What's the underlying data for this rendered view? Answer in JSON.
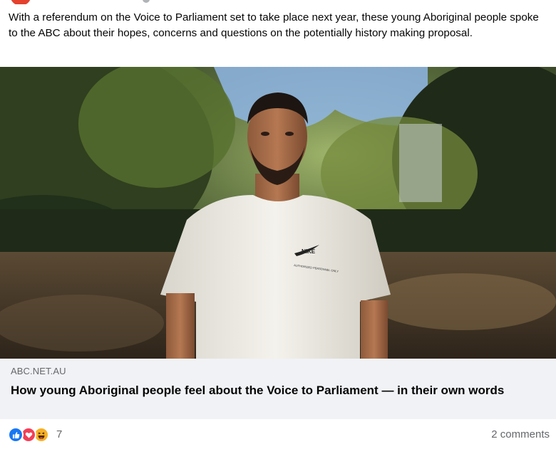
{
  "post": {
    "text": "With a referendum on the Voice to Parliament set to take place next year, these young Aboriginal people spoke to the ABC about their hopes, concerns and questions on the potentially history making proposal."
  },
  "link_preview": {
    "domain": "ABC.NET.AU",
    "title": "How young Aboriginal people feel about the Voice to Parliament — in their own words",
    "image_alt": "Young man in white t-shirt standing in a park",
    "shirt_logo_text": "NIKE",
    "shirt_text": "AUTHORIZED PERSONNEL ONLY"
  },
  "reactions": {
    "icons": [
      "like-icon",
      "love-icon",
      "haha-icon"
    ],
    "count": "7"
  },
  "comments": {
    "label": "2 comments"
  },
  "colors": {
    "like": "#1877f2",
    "love": "#f33e58",
    "haha": "#f7b125",
    "meta_bg": "#f0f2f5",
    "secondary_text": "#65676b"
  }
}
